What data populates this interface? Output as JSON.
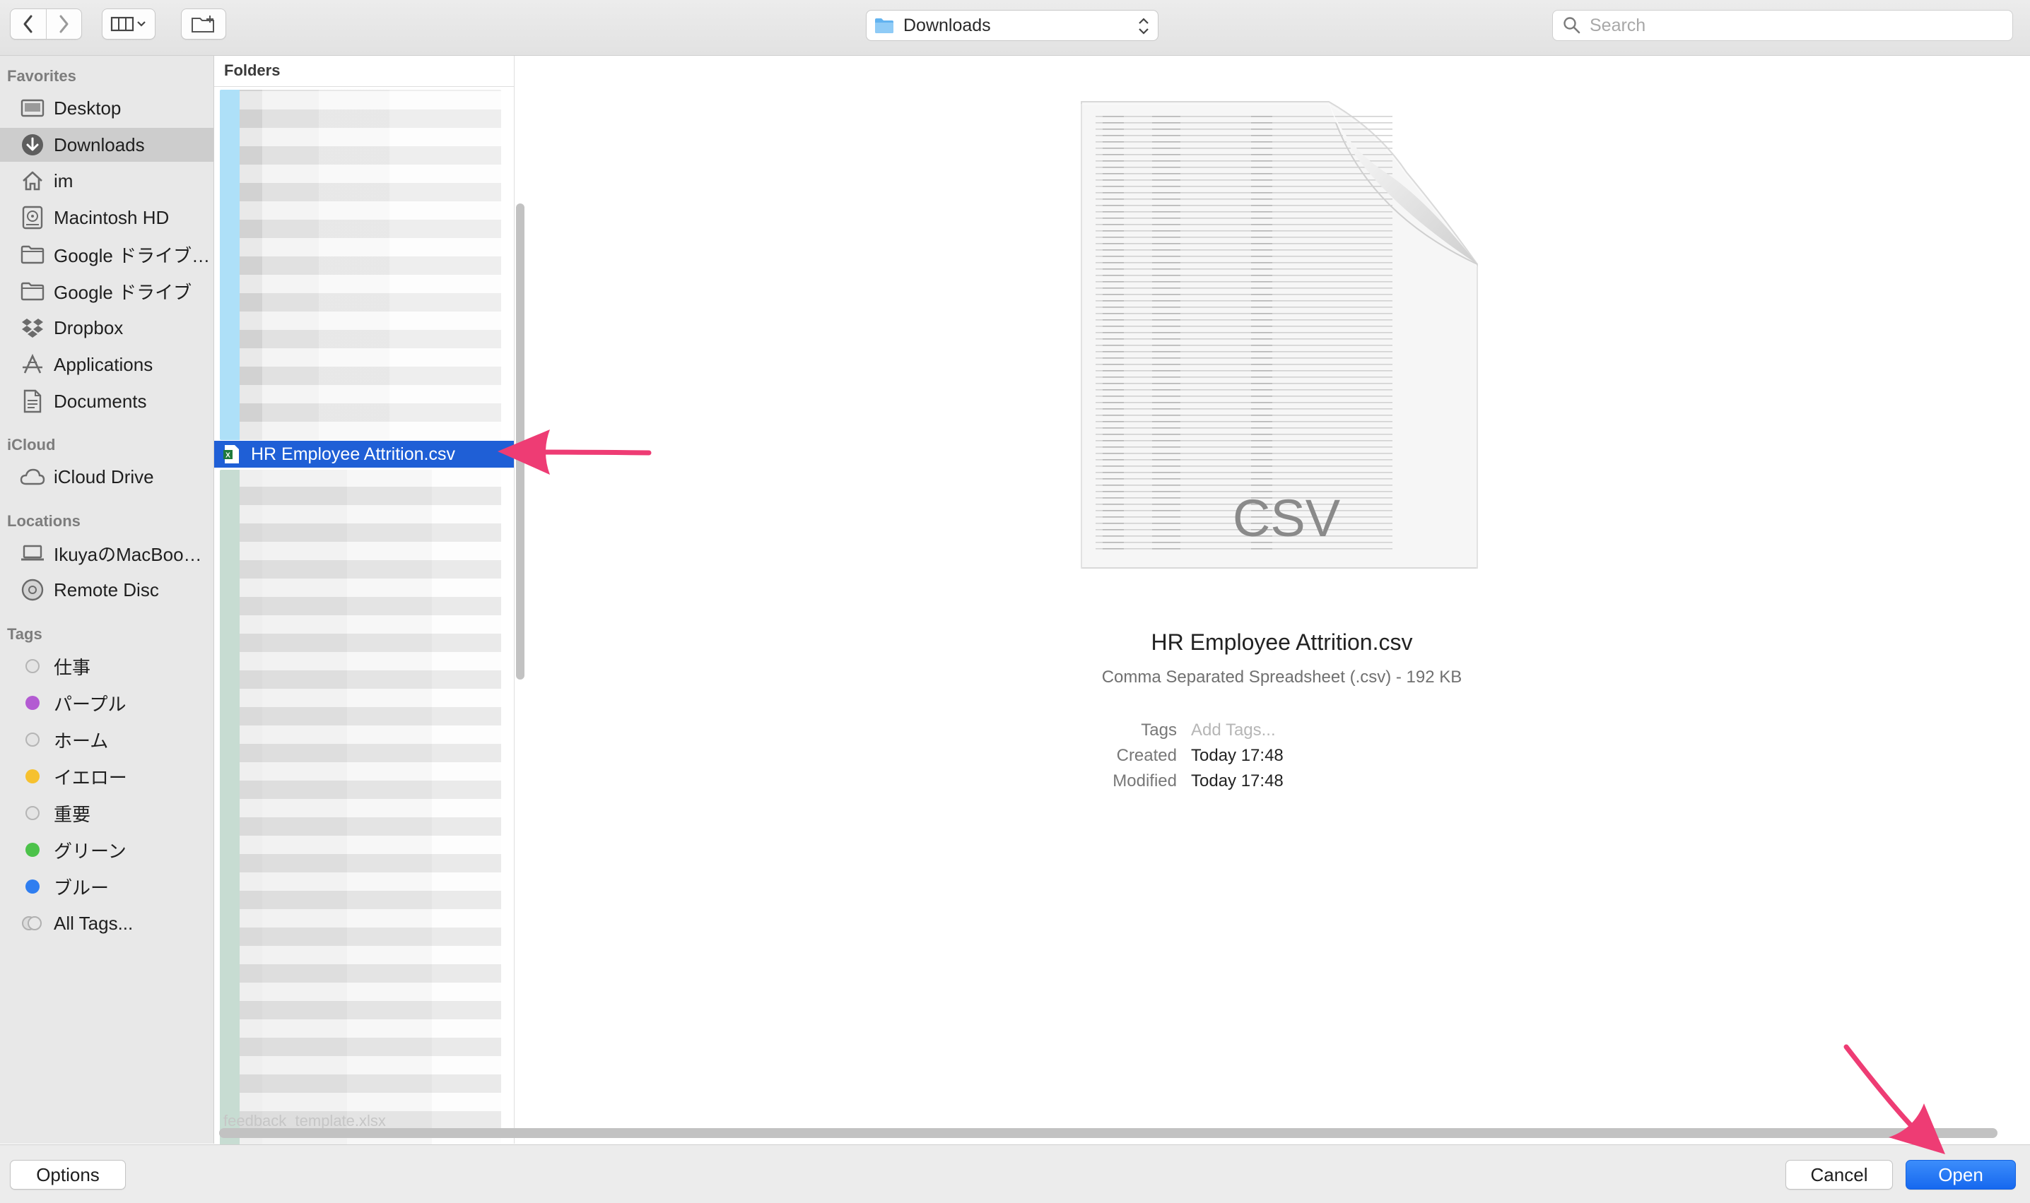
{
  "toolbar": {
    "location": "Downloads",
    "search_placeholder": "Search"
  },
  "sidebar": {
    "favorites_title": "Favorites",
    "favorites": [
      {
        "label": "Desktop",
        "icon": "desktop-icon"
      },
      {
        "label": "Downloads",
        "icon": "downloads-icon",
        "selected": true
      },
      {
        "label": "im",
        "icon": "home-icon"
      },
      {
        "label": "Macintosh HD",
        "icon": "harddisk-icon"
      },
      {
        "label": "Google ドライブ…",
        "icon": "folder-icon"
      },
      {
        "label": "Google ドライブ",
        "icon": "folder-icon"
      },
      {
        "label": "Dropbox",
        "icon": "dropbox-icon"
      },
      {
        "label": "Applications",
        "icon": "applications-icon"
      },
      {
        "label": "Documents",
        "icon": "documents-icon"
      }
    ],
    "icloud_title": "iCloud",
    "icloud": [
      {
        "label": "iCloud Drive",
        "icon": "cloud-icon"
      }
    ],
    "locations_title": "Locations",
    "locations": [
      {
        "label": "IkuyaのMacBoo…",
        "icon": "laptop-icon"
      },
      {
        "label": "Remote Disc",
        "icon": "disc-icon"
      }
    ],
    "tags_title": "Tags",
    "tags": [
      {
        "label": "仕事",
        "color": "#d0d0d0"
      },
      {
        "label": "パープル",
        "color": "#b35bd2"
      },
      {
        "label": "ホーム",
        "color": "#d0d0d0"
      },
      {
        "label": "イエロー",
        "color": "#f6c12f"
      },
      {
        "label": "重要",
        "color": "#d0d0d0"
      },
      {
        "label": "グリーン",
        "color": "#4cc24a"
      },
      {
        "label": "ブルー",
        "color": "#2f7ef0"
      },
      {
        "label": "All Tags...",
        "color": "#cfcfcf"
      }
    ]
  },
  "column": {
    "header": "Folders",
    "selected_file": "HR Employee Attrition.csv",
    "cutoff_file": "feedback_template.xlsx"
  },
  "preview": {
    "doc_badge": "CSV",
    "file_name": "HR Employee Attrition.csv",
    "file_meta": "Comma Separated Spreadsheet (.csv) - 192 KB",
    "tags_label": "Tags",
    "tags_placeholder": "Add Tags...",
    "created_label": "Created",
    "created_value": "Today 17:48",
    "modified_label": "Modified",
    "modified_value": "Today 17:48"
  },
  "bottom": {
    "options_label": "Options",
    "cancel_label": "Cancel",
    "open_label": "Open"
  },
  "colors": {
    "selection": "#1f5fd6",
    "arrow": "#ee3c74",
    "primary_button": "#1668ef"
  }
}
